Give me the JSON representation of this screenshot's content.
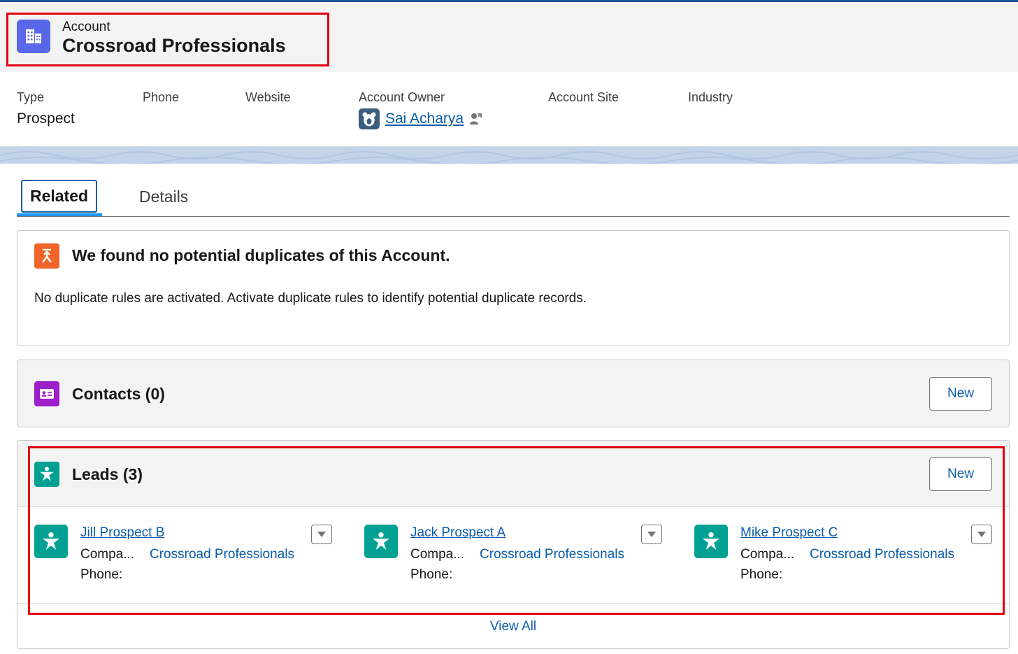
{
  "header": {
    "object_label": "Account",
    "record_name": "Crossroad Professionals",
    "icon": "account-building-icon",
    "icon_color": "#5867e8"
  },
  "fields": {
    "type": {
      "label": "Type",
      "value": "Prospect"
    },
    "phone": {
      "label": "Phone",
      "value": ""
    },
    "website": {
      "label": "Website",
      "value": ""
    },
    "account_owner": {
      "label": "Account Owner",
      "value": "Sai Acharya"
    },
    "account_site": {
      "label": "Account Site",
      "value": ""
    },
    "industry": {
      "label": "Industry",
      "value": ""
    }
  },
  "tabs": {
    "related": "Related",
    "details": "Details",
    "active": "Related"
  },
  "duplicates": {
    "title": "We found no potential duplicates of this Account.",
    "message": "No duplicate rules are activated. Activate duplicate rules to identify potential duplicate records.",
    "icon_color": "#f2642a"
  },
  "contacts": {
    "title": "Contacts (0)",
    "new_label": "New",
    "icon_color": "#9e1ec9"
  },
  "leads": {
    "title": "Leads (3)",
    "new_label": "New",
    "icon_color": "#00a193",
    "view_all": "View All",
    "items": [
      {
        "name": "Jill Prospect B",
        "company_label": "Compa...",
        "company": "Crossroad Professionals",
        "phone_label": "Phone:"
      },
      {
        "name": "Jack Prospect A",
        "company_label": "Compa...",
        "company": "Crossroad Professionals",
        "phone_label": "Phone:"
      },
      {
        "name": "Mike Prospect C",
        "company_label": "Compa...",
        "company": "Crossroad Professionals",
        "phone_label": "Phone:"
      }
    ]
  },
  "colors": {
    "link": "#0b5cab",
    "highlight_box": "#e3000f",
    "tab_active": "#1b96ff"
  }
}
